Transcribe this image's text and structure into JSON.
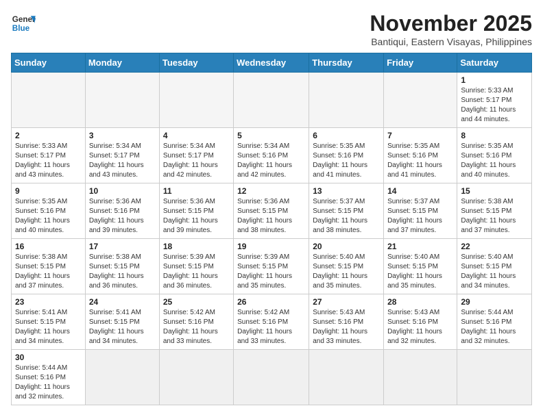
{
  "header": {
    "logo_general": "General",
    "logo_blue": "Blue",
    "month_year": "November 2025",
    "location": "Bantiqui, Eastern Visayas, Philippines"
  },
  "weekdays": [
    "Sunday",
    "Monday",
    "Tuesday",
    "Wednesday",
    "Thursday",
    "Friday",
    "Saturday"
  ],
  "weeks": [
    [
      {
        "day": "",
        "info": ""
      },
      {
        "day": "",
        "info": ""
      },
      {
        "day": "",
        "info": ""
      },
      {
        "day": "",
        "info": ""
      },
      {
        "day": "",
        "info": ""
      },
      {
        "day": "",
        "info": ""
      },
      {
        "day": "1",
        "info": "Sunrise: 5:33 AM\nSunset: 5:17 PM\nDaylight: 11 hours\nand 44 minutes."
      }
    ],
    [
      {
        "day": "2",
        "info": "Sunrise: 5:33 AM\nSunset: 5:17 PM\nDaylight: 11 hours\nand 43 minutes."
      },
      {
        "day": "3",
        "info": "Sunrise: 5:34 AM\nSunset: 5:17 PM\nDaylight: 11 hours\nand 43 minutes."
      },
      {
        "day": "4",
        "info": "Sunrise: 5:34 AM\nSunset: 5:17 PM\nDaylight: 11 hours\nand 42 minutes."
      },
      {
        "day": "5",
        "info": "Sunrise: 5:34 AM\nSunset: 5:16 PM\nDaylight: 11 hours\nand 42 minutes."
      },
      {
        "day": "6",
        "info": "Sunrise: 5:35 AM\nSunset: 5:16 PM\nDaylight: 11 hours\nand 41 minutes."
      },
      {
        "day": "7",
        "info": "Sunrise: 5:35 AM\nSunset: 5:16 PM\nDaylight: 11 hours\nand 41 minutes."
      },
      {
        "day": "8",
        "info": "Sunrise: 5:35 AM\nSunset: 5:16 PM\nDaylight: 11 hours\nand 40 minutes."
      }
    ],
    [
      {
        "day": "9",
        "info": "Sunrise: 5:35 AM\nSunset: 5:16 PM\nDaylight: 11 hours\nand 40 minutes."
      },
      {
        "day": "10",
        "info": "Sunrise: 5:36 AM\nSunset: 5:16 PM\nDaylight: 11 hours\nand 39 minutes."
      },
      {
        "day": "11",
        "info": "Sunrise: 5:36 AM\nSunset: 5:15 PM\nDaylight: 11 hours\nand 39 minutes."
      },
      {
        "day": "12",
        "info": "Sunrise: 5:36 AM\nSunset: 5:15 PM\nDaylight: 11 hours\nand 38 minutes."
      },
      {
        "day": "13",
        "info": "Sunrise: 5:37 AM\nSunset: 5:15 PM\nDaylight: 11 hours\nand 38 minutes."
      },
      {
        "day": "14",
        "info": "Sunrise: 5:37 AM\nSunset: 5:15 PM\nDaylight: 11 hours\nand 37 minutes."
      },
      {
        "day": "15",
        "info": "Sunrise: 5:38 AM\nSunset: 5:15 PM\nDaylight: 11 hours\nand 37 minutes."
      }
    ],
    [
      {
        "day": "16",
        "info": "Sunrise: 5:38 AM\nSunset: 5:15 PM\nDaylight: 11 hours\nand 37 minutes."
      },
      {
        "day": "17",
        "info": "Sunrise: 5:38 AM\nSunset: 5:15 PM\nDaylight: 11 hours\nand 36 minutes."
      },
      {
        "day": "18",
        "info": "Sunrise: 5:39 AM\nSunset: 5:15 PM\nDaylight: 11 hours\nand 36 minutes."
      },
      {
        "day": "19",
        "info": "Sunrise: 5:39 AM\nSunset: 5:15 PM\nDaylight: 11 hours\nand 35 minutes."
      },
      {
        "day": "20",
        "info": "Sunrise: 5:40 AM\nSunset: 5:15 PM\nDaylight: 11 hours\nand 35 minutes."
      },
      {
        "day": "21",
        "info": "Sunrise: 5:40 AM\nSunset: 5:15 PM\nDaylight: 11 hours\nand 35 minutes."
      },
      {
        "day": "22",
        "info": "Sunrise: 5:40 AM\nSunset: 5:15 PM\nDaylight: 11 hours\nand 34 minutes."
      }
    ],
    [
      {
        "day": "23",
        "info": "Sunrise: 5:41 AM\nSunset: 5:15 PM\nDaylight: 11 hours\nand 34 minutes."
      },
      {
        "day": "24",
        "info": "Sunrise: 5:41 AM\nSunset: 5:15 PM\nDaylight: 11 hours\nand 34 minutes."
      },
      {
        "day": "25",
        "info": "Sunrise: 5:42 AM\nSunset: 5:16 PM\nDaylight: 11 hours\nand 33 minutes."
      },
      {
        "day": "26",
        "info": "Sunrise: 5:42 AM\nSunset: 5:16 PM\nDaylight: 11 hours\nand 33 minutes."
      },
      {
        "day": "27",
        "info": "Sunrise: 5:43 AM\nSunset: 5:16 PM\nDaylight: 11 hours\nand 33 minutes."
      },
      {
        "day": "28",
        "info": "Sunrise: 5:43 AM\nSunset: 5:16 PM\nDaylight: 11 hours\nand 32 minutes."
      },
      {
        "day": "29",
        "info": "Sunrise: 5:44 AM\nSunset: 5:16 PM\nDaylight: 11 hours\nand 32 minutes."
      }
    ],
    [
      {
        "day": "30",
        "info": "Sunrise: 5:44 AM\nSunset: 5:16 PM\nDaylight: 11 hours\nand 32 minutes."
      },
      {
        "day": "",
        "info": ""
      },
      {
        "day": "",
        "info": ""
      },
      {
        "day": "",
        "info": ""
      },
      {
        "day": "",
        "info": ""
      },
      {
        "day": "",
        "info": ""
      },
      {
        "day": "",
        "info": ""
      }
    ]
  ]
}
